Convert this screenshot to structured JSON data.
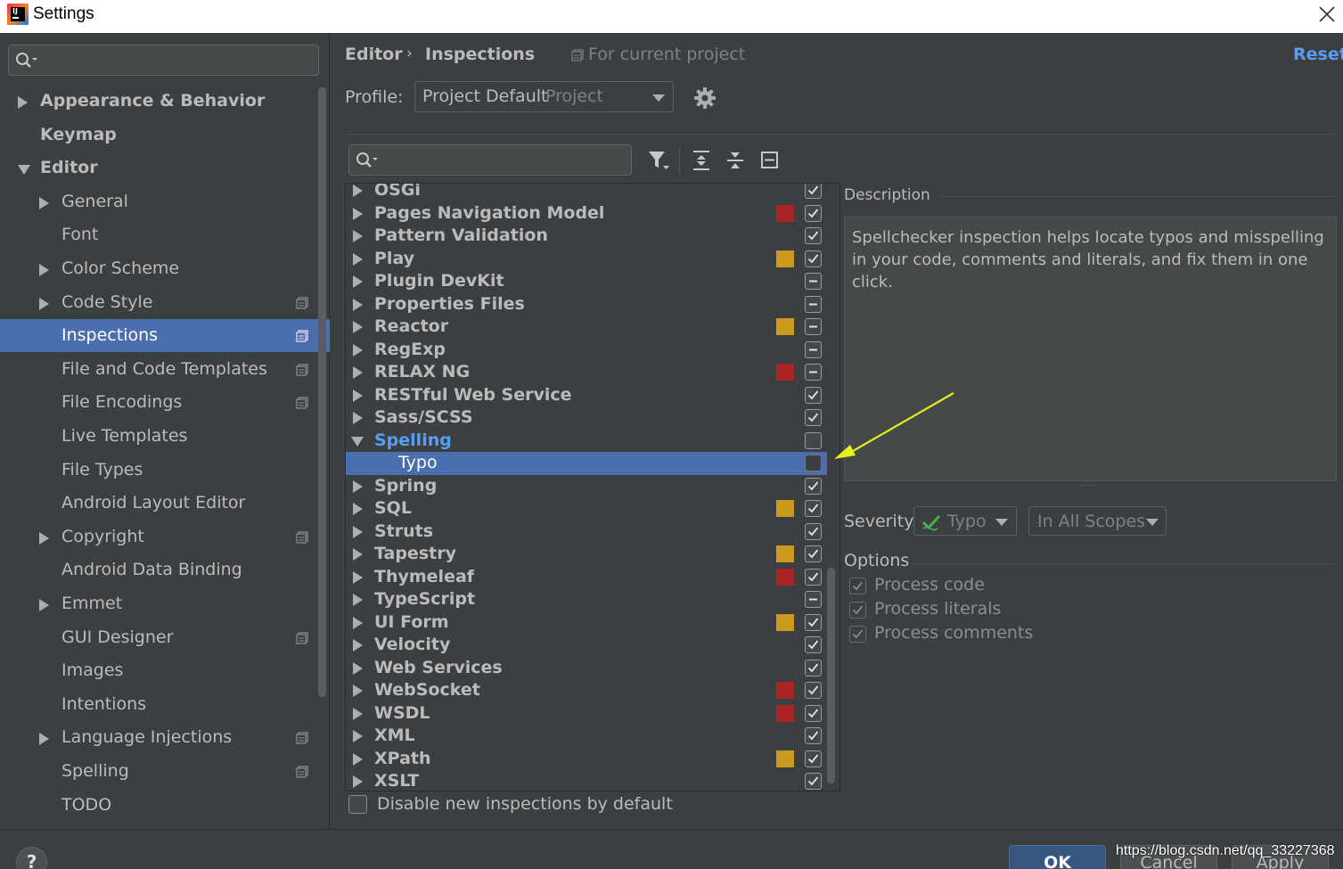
{
  "window": {
    "title": "Settings"
  },
  "sidebar": {
    "search": {
      "placeholder": ""
    },
    "items": [
      {
        "label": "Appearance & Behavior",
        "level": 0,
        "expander": "collapsed",
        "bold": true,
        "project_icon": false,
        "selected": false
      },
      {
        "label": "Keymap",
        "level": 0,
        "expander": "none",
        "bold": true,
        "project_icon": false,
        "selected": false
      },
      {
        "label": "Editor",
        "level": 0,
        "expander": "expanded",
        "bold": true,
        "project_icon": false,
        "selected": false
      },
      {
        "label": "General",
        "level": 1,
        "expander": "collapsed",
        "bold": false,
        "project_icon": false,
        "selected": false
      },
      {
        "label": "Font",
        "level": 1,
        "expander": "none",
        "bold": false,
        "project_icon": false,
        "selected": false
      },
      {
        "label": "Color Scheme",
        "level": 1,
        "expander": "collapsed",
        "bold": false,
        "project_icon": false,
        "selected": false
      },
      {
        "label": "Code Style",
        "level": 1,
        "expander": "collapsed",
        "bold": false,
        "project_icon": true,
        "selected": false
      },
      {
        "label": "Inspections",
        "level": 1,
        "expander": "none",
        "bold": false,
        "project_icon": true,
        "selected": true
      },
      {
        "label": "File and Code Templates",
        "level": 1,
        "expander": "none",
        "bold": false,
        "project_icon": true,
        "selected": false
      },
      {
        "label": "File Encodings",
        "level": 1,
        "expander": "none",
        "bold": false,
        "project_icon": true,
        "selected": false
      },
      {
        "label": "Live Templates",
        "level": 1,
        "expander": "none",
        "bold": false,
        "project_icon": false,
        "selected": false
      },
      {
        "label": "File Types",
        "level": 1,
        "expander": "none",
        "bold": false,
        "project_icon": false,
        "selected": false
      },
      {
        "label": "Android Layout Editor",
        "level": 1,
        "expander": "none",
        "bold": false,
        "project_icon": false,
        "selected": false
      },
      {
        "label": "Copyright",
        "level": 1,
        "expander": "collapsed",
        "bold": false,
        "project_icon": true,
        "selected": false
      },
      {
        "label": "Android Data Binding",
        "level": 1,
        "expander": "none",
        "bold": false,
        "project_icon": false,
        "selected": false
      },
      {
        "label": "Emmet",
        "level": 1,
        "expander": "collapsed",
        "bold": false,
        "project_icon": false,
        "selected": false
      },
      {
        "label": "GUI Designer",
        "level": 1,
        "expander": "none",
        "bold": false,
        "project_icon": true,
        "selected": false
      },
      {
        "label": "Images",
        "level": 1,
        "expander": "none",
        "bold": false,
        "project_icon": false,
        "selected": false
      },
      {
        "label": "Intentions",
        "level": 1,
        "expander": "none",
        "bold": false,
        "project_icon": false,
        "selected": false
      },
      {
        "label": "Language Injections",
        "level": 1,
        "expander": "collapsed",
        "bold": false,
        "project_icon": true,
        "selected": false
      },
      {
        "label": "Spelling",
        "level": 1,
        "expander": "none",
        "bold": false,
        "project_icon": true,
        "selected": false
      },
      {
        "label": "TODO",
        "level": 1,
        "expander": "none",
        "bold": false,
        "project_icon": false,
        "selected": false
      }
    ]
  },
  "header": {
    "breadcrumb": [
      "Editor",
      "Inspections"
    ],
    "breadcrumb_separator": "›",
    "scope_label": "For current project",
    "reset_label": "Reset"
  },
  "profile": {
    "label": "Profile:",
    "name": "Project Default",
    "type": "Project"
  },
  "toolbar": {
    "search_placeholder": "",
    "icons": [
      "filter-icon",
      "expand-all-icon",
      "collapse-all-icon",
      "reset-to-empty-icon"
    ]
  },
  "colors": {
    "accent": "#4b6eaf",
    "link": "#589df6",
    "severity_error": "#a92525",
    "severity_warning": "#c99a1e",
    "annotation_arrow": "#e4f01c"
  },
  "inspections": [
    {
      "label": "OSGi",
      "expander": "collapsed",
      "severity": "none",
      "state": "checked"
    },
    {
      "label": "Pages Navigation Model",
      "expander": "collapsed",
      "severity": "error",
      "state": "checked"
    },
    {
      "label": "Pattern Validation",
      "expander": "collapsed",
      "severity": "none",
      "state": "checked"
    },
    {
      "label": "Play",
      "expander": "collapsed",
      "severity": "warning",
      "state": "checked"
    },
    {
      "label": "Plugin DevKit",
      "expander": "collapsed",
      "severity": "none",
      "state": "mixed"
    },
    {
      "label": "Properties Files",
      "expander": "collapsed",
      "severity": "none",
      "state": "mixed"
    },
    {
      "label": "Reactor",
      "expander": "collapsed",
      "severity": "warning",
      "state": "mixed"
    },
    {
      "label": "RegExp",
      "expander": "collapsed",
      "severity": "none",
      "state": "mixed"
    },
    {
      "label": "RELAX NG",
      "expander": "collapsed",
      "severity": "error",
      "state": "mixed"
    },
    {
      "label": "RESTful Web Service",
      "expander": "collapsed",
      "severity": "none",
      "state": "checked"
    },
    {
      "label": "Sass/SCSS",
      "expander": "collapsed",
      "severity": "none",
      "state": "checked"
    },
    {
      "label": "Spelling",
      "expander": "expanded",
      "severity": "none",
      "state": "unchecked",
      "highlight": true
    },
    {
      "label": "Typo",
      "expander": "none",
      "severity": "none",
      "state": "unchecked",
      "child": true,
      "selected": true
    },
    {
      "label": "Spring",
      "expander": "collapsed",
      "severity": "none",
      "state": "checked"
    },
    {
      "label": "SQL",
      "expander": "collapsed",
      "severity": "warning",
      "state": "checked"
    },
    {
      "label": "Struts",
      "expander": "collapsed",
      "severity": "none",
      "state": "checked"
    },
    {
      "label": "Tapestry",
      "expander": "collapsed",
      "severity": "warning",
      "state": "checked"
    },
    {
      "label": "Thymeleaf",
      "expander": "collapsed",
      "severity": "error",
      "state": "checked"
    },
    {
      "label": "TypeScript",
      "expander": "collapsed",
      "severity": "none",
      "state": "mixed"
    },
    {
      "label": "UI Form",
      "expander": "collapsed",
      "severity": "warning",
      "state": "checked"
    },
    {
      "label": "Velocity",
      "expander": "collapsed",
      "severity": "none",
      "state": "checked"
    },
    {
      "label": "Web Services",
      "expander": "collapsed",
      "severity": "none",
      "state": "checked"
    },
    {
      "label": "WebSocket",
      "expander": "collapsed",
      "severity": "error",
      "state": "checked"
    },
    {
      "label": "WSDL",
      "expander": "collapsed",
      "severity": "error",
      "state": "checked"
    },
    {
      "label": "XML",
      "expander": "collapsed",
      "severity": "none",
      "state": "checked"
    },
    {
      "label": "XPath",
      "expander": "collapsed",
      "severity": "warning",
      "state": "checked"
    },
    {
      "label": "XSLT",
      "expander": "collapsed",
      "severity": "none",
      "state": "checked"
    }
  ],
  "disable_new": {
    "label": "Disable new inspections by default",
    "checked": false
  },
  "description": {
    "title": "Description",
    "text": "Spellchecker inspection helps locate typos and misspelling in your code, comments and literals, and fix them in one click."
  },
  "severity": {
    "label": "Severity:",
    "value": "Typo",
    "scope": "In All Scopes"
  },
  "options": {
    "title": "Options",
    "items": [
      {
        "label": "Process code",
        "checked": true
      },
      {
        "label": "Process literals",
        "checked": true
      },
      {
        "label": "Process comments",
        "checked": true
      }
    ]
  },
  "footer": {
    "help_label": "?",
    "ok_label": "OK",
    "cancel_label": "Cancel",
    "apply_label": "Apply"
  },
  "watermark": "https://blog.csdn.net/qq_33227368"
}
